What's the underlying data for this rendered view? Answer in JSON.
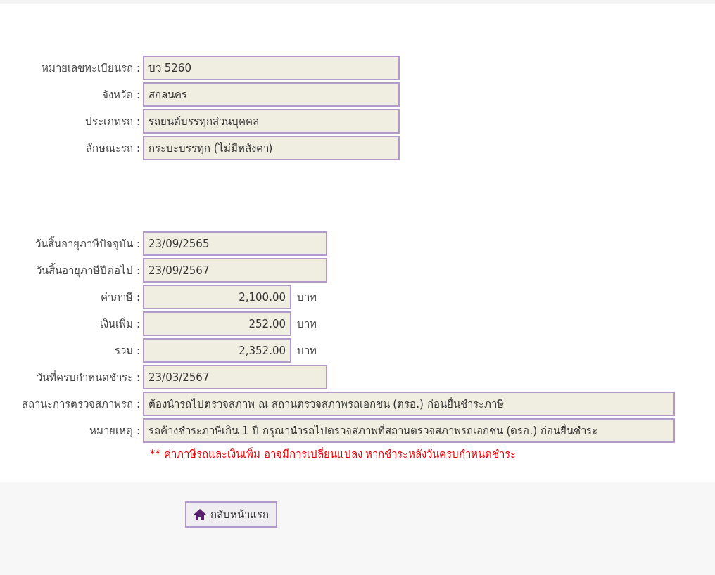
{
  "vehicle": [
    {
      "label": "หมายเลขทะเบียนรถ :",
      "value": "บว 5260",
      "kind": "wide"
    },
    {
      "label": "จังหวัด :",
      "value": "สกลนคร",
      "kind": "wide"
    },
    {
      "label": "ประเภทรถ :",
      "value": "รถยนต์บรรทุกส่วนบุคคล",
      "kind": "wide"
    },
    {
      "label": "ลักษณะรถ :",
      "value": "กระบะบรรทุก (ไม่มีหลังคา)",
      "kind": "wide"
    }
  ],
  "tax": [
    {
      "label": "วันสิ้นอายุภาษีปัจจุบัน :",
      "value": "23/09/2565",
      "kind": "medium"
    },
    {
      "label": "วันสิ้นอายุภาษีปีต่อไป :",
      "value": "23/09/2567",
      "kind": "medium"
    },
    {
      "label": "ค่าภาษี :",
      "value": "2,100.00",
      "kind": "amount",
      "unit": "บาท"
    },
    {
      "label": "เงินเพิ่ม :",
      "value": "252.00",
      "kind": "amount",
      "unit": "บาท"
    },
    {
      "label": "รวม :",
      "value": "2,352.00",
      "kind": "amount",
      "unit": "บาท"
    },
    {
      "label": "วันที่ครบกำหนดชำระ :",
      "value": "23/03/2567",
      "kind": "medium"
    },
    {
      "label": "สถานะการตรวจสภาพรถ :",
      "value": "ต้องนำรถไปตรวจสภาพ ณ สถานตรวจสภาพรถเอกชน (ตรอ.) ก่อนยื่นชำระภาษี",
      "kind": "full"
    },
    {
      "label": "หมายเหตุ :",
      "value": "รถค้างชำระภาษีเกิน 1 ปี กรุณานำรถไปตรวจสภาพที่สถานตรวจสภาพรถเอกชน (ตรอ.) ก่อนยื่นชำระ",
      "kind": "full"
    }
  ],
  "warning": "** ค่าภาษีรถและเงินเพิ่ม อาจมีการเปลี่ยนแปลง หากชำระหลังวันครบกำหนดชำระ",
  "home_button": "กลับหน้าแรก"
}
